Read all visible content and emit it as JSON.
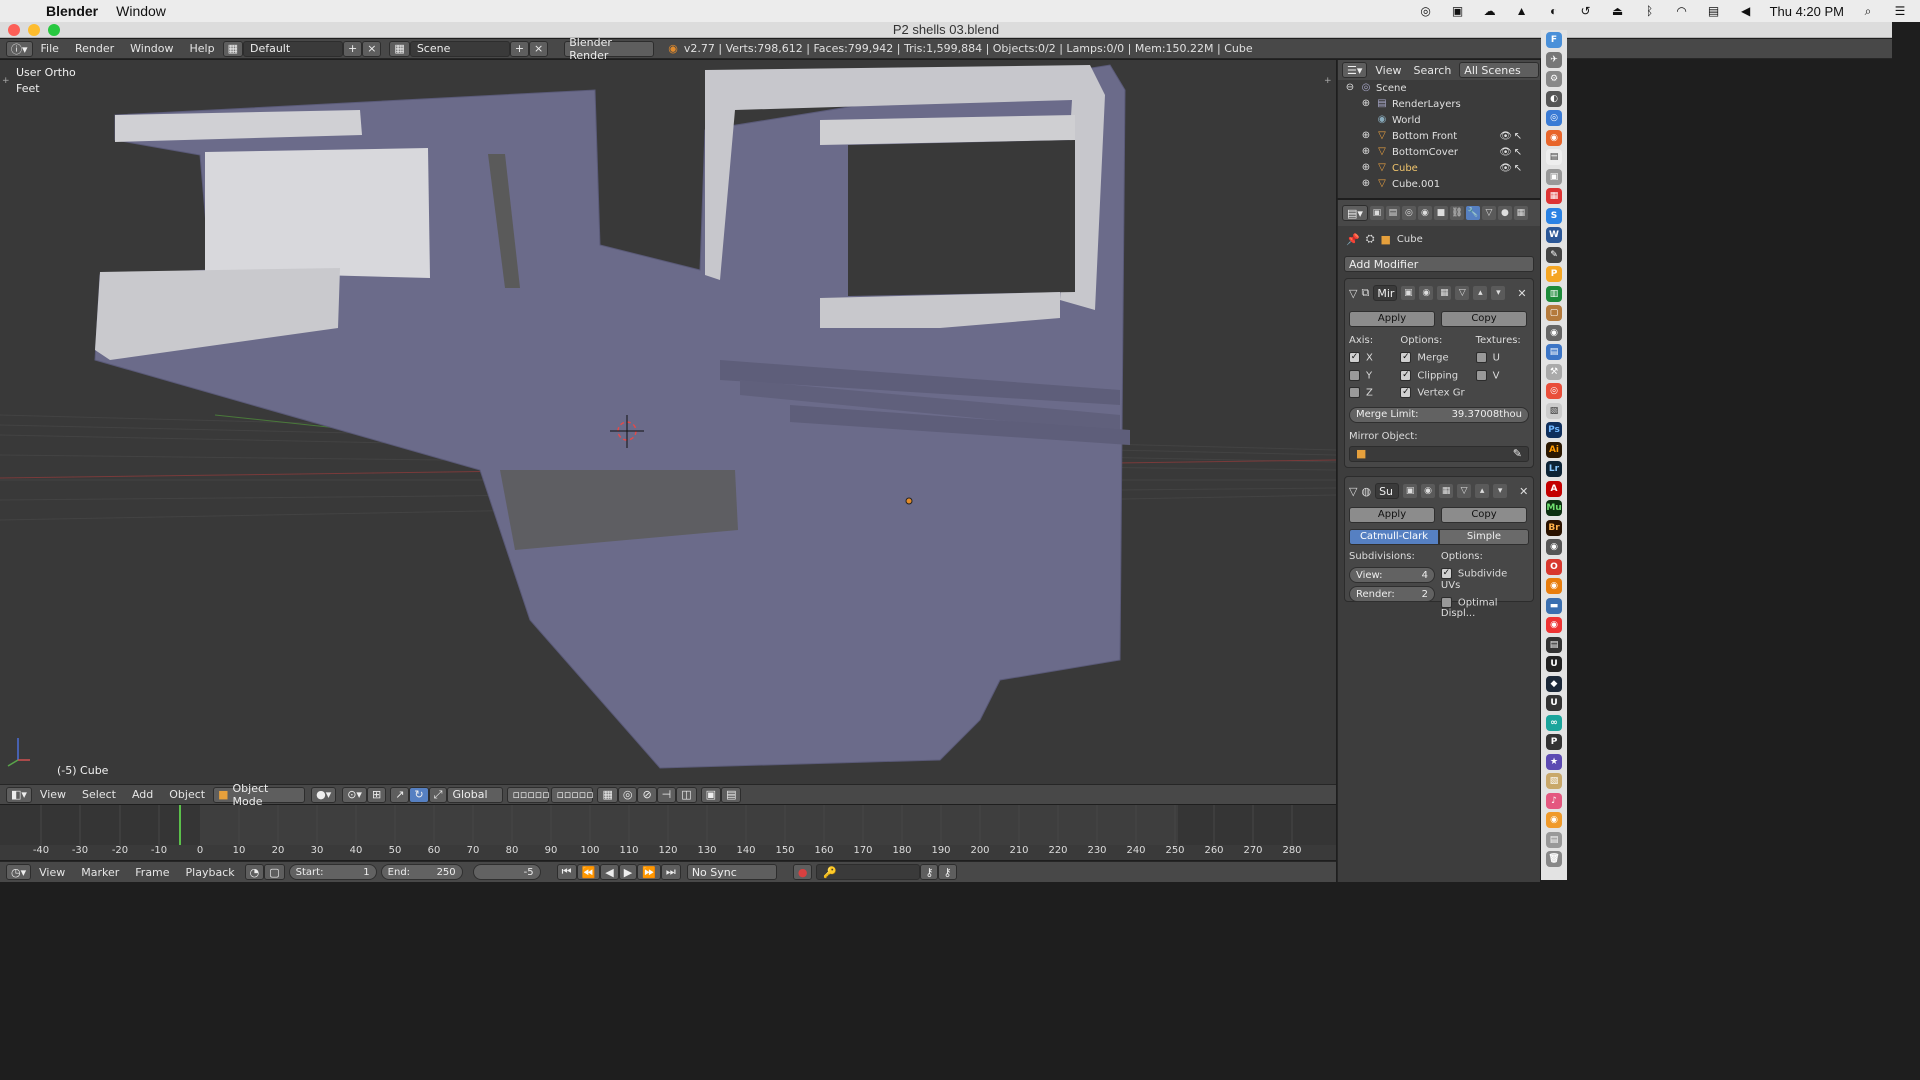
{
  "mac": {
    "apple": "",
    "app_name": "Blender",
    "menu_window": "Window",
    "clock": "Thu 4:20 PM"
  },
  "window": {
    "title": "P2 shells 03.blend"
  },
  "info_header": {
    "menus": [
      "File",
      "Render",
      "Window",
      "Help"
    ],
    "layout": "Default",
    "scene": "Scene",
    "engine": "Blender Render",
    "stats": "v2.77 | Verts:798,612 | Faces:799,942 | Tris:1,599,884 | Objects:0/2 | Lamps:0/0 | Mem:150.22M | Cube"
  },
  "viewport": {
    "view_name": "User Ortho",
    "units": "Feet",
    "object_label": "(-5) Cube"
  },
  "view3d_header": {
    "menus": [
      "View",
      "Select",
      "Add",
      "Object"
    ],
    "mode": "Object Mode",
    "orientation": "Global"
  },
  "timeline": {
    "ticks": [
      "-40",
      "-30",
      "-20",
      "-10",
      "0",
      "10",
      "20",
      "30",
      "40",
      "50",
      "60",
      "70",
      "80",
      "90",
      "100",
      "110",
      "120",
      "130",
      "140",
      "150",
      "160",
      "170",
      "180",
      "190",
      "200",
      "210",
      "220",
      "230",
      "240",
      "250",
      "260",
      "270",
      "280"
    ],
    "menus": [
      "View",
      "Marker",
      "Frame",
      "Playback"
    ],
    "start_label": "Start:",
    "start_value": "1",
    "end_label": "End:",
    "end_value": "250",
    "current_frame": "-5",
    "sync": "No Sync"
  },
  "outliner": {
    "menus": [
      "View",
      "Search"
    ],
    "filter": "All Scenes",
    "rows": [
      "Scene",
      "RenderLayers",
      "World",
      "Bottom Front",
      "BottomCover",
      "Cube",
      "Cube.001"
    ]
  },
  "properties": {
    "context_object": "Cube",
    "add_modifier": "Add Modifier",
    "mirror": {
      "name": "Mir",
      "apply": "Apply",
      "copy": "Copy",
      "axis_label": "Axis:",
      "options_label": "Options:",
      "textures_label": "Textures:",
      "axis": [
        {
          "label": "X",
          "checked": true
        },
        {
          "label": "Y",
          "checked": false
        },
        {
          "label": "Z",
          "checked": false
        }
      ],
      "options": [
        {
          "label": "Merge",
          "checked": true
        },
        {
          "label": "Clipping",
          "checked": true
        },
        {
          "label": "Vertex Gr",
          "checked": true
        }
      ],
      "textures": [
        {
          "label": "U",
          "checked": false
        },
        {
          "label": "V",
          "checked": false
        }
      ],
      "merge_limit_label": "Merge Limit:",
      "merge_limit_value": "39.37008thou",
      "mirror_object_label": "Mirror Object:"
    },
    "subsurf": {
      "name": "Su",
      "apply": "Apply",
      "copy": "Copy",
      "catmull": "Catmull-Clark",
      "simple": "Simple",
      "subdivisions_label": "Subdivisions:",
      "options_label": "Options:",
      "view_label": "View:",
      "view_value": "4",
      "render_label": "Render:",
      "render_value": "2",
      "subdivide_uvs": "Subdivide UVs",
      "optimal_display": "Optimal Displ..."
    }
  }
}
